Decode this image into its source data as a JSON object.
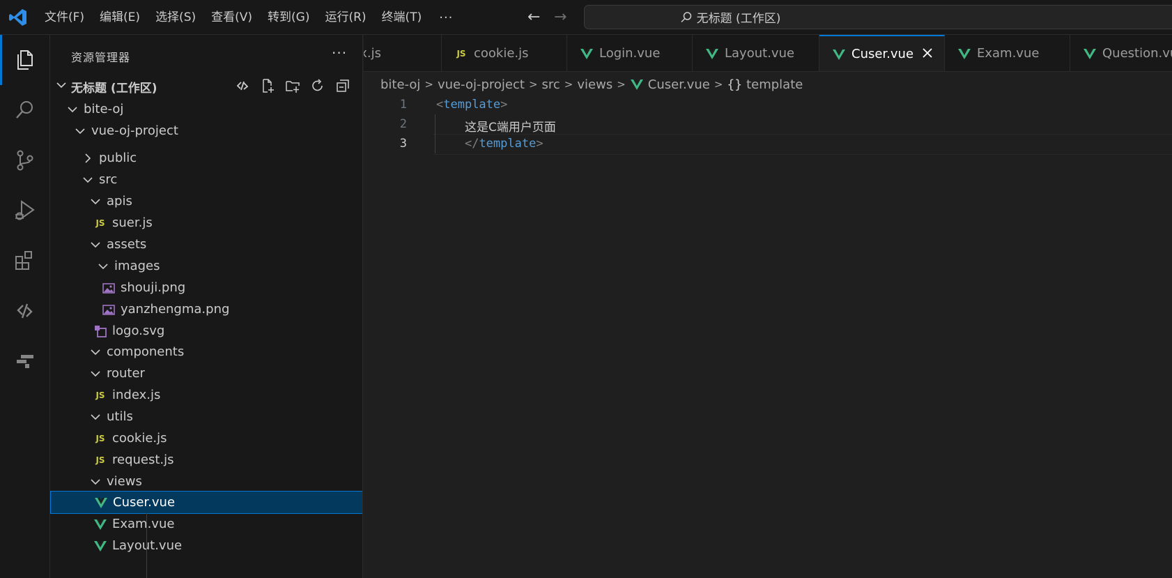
{
  "menu": [
    "文件(F)",
    "编辑(E)",
    "选择(S)",
    "查看(V)",
    "转到(G)",
    "运行(R)",
    "终端(T)"
  ],
  "menu_more": "···",
  "nav": {
    "back": "←",
    "forward": "→"
  },
  "command_center": {
    "text": "无标题 (工作区)"
  },
  "sidebar": {
    "title": "资源管理器",
    "more": "···",
    "workspace": "无标题 (工作区)",
    "tree": [
      {
        "label": "bite-oj",
        "type": "folder-open",
        "depth": 0
      },
      {
        "label": "vue-oj-project",
        "type": "folder-open",
        "depth": 1
      },
      {
        "label": "public",
        "type": "folder-closed",
        "depth": 2
      },
      {
        "label": "src",
        "type": "folder-open",
        "depth": 2
      },
      {
        "label": "apis",
        "type": "folder-open",
        "depth": 3
      },
      {
        "label": "suer.js",
        "type": "js",
        "depth": 4
      },
      {
        "label": "assets",
        "type": "folder-open",
        "depth": 3
      },
      {
        "label": "images",
        "type": "folder-open",
        "depth": 4
      },
      {
        "label": "shouji.png",
        "type": "image",
        "depth": 5
      },
      {
        "label": "yanzhengma.png",
        "type": "image",
        "depth": 5
      },
      {
        "label": "logo.svg",
        "type": "svg",
        "depth": 4
      },
      {
        "label": "components",
        "type": "folder-open",
        "depth": 3
      },
      {
        "label": "router",
        "type": "folder-open",
        "depth": 3
      },
      {
        "label": "index.js",
        "type": "js",
        "depth": 4
      },
      {
        "label": "utils",
        "type": "folder-open",
        "depth": 3
      },
      {
        "label": "cookie.js",
        "type": "js",
        "depth": 4
      },
      {
        "label": "request.js",
        "type": "js",
        "depth": 4
      },
      {
        "label": "views",
        "type": "folder-open",
        "depth": 3
      },
      {
        "label": "Cuser.vue",
        "type": "vue",
        "depth": 4,
        "selected": true
      },
      {
        "label": "Exam.vue",
        "type": "vue",
        "depth": 4
      },
      {
        "label": "Layout.vue",
        "type": "vue",
        "depth": 4
      }
    ]
  },
  "tabs": [
    {
      "label": "x.js",
      "type": "none"
    },
    {
      "label": "cookie.js",
      "type": "js"
    },
    {
      "label": "Login.vue",
      "type": "vue"
    },
    {
      "label": "Layout.vue",
      "type": "vue"
    },
    {
      "label": "Cuser.vue",
      "type": "vue",
      "active": true
    },
    {
      "label": "Exam.vue",
      "type": "vue"
    },
    {
      "label": "Question.vue",
      "type": "vue"
    }
  ],
  "breadcrumb": [
    "bite-oj",
    "vue-oj-project",
    "src",
    "views",
    "Cuser.vue",
    "template"
  ],
  "breadcrumb_sep": ">",
  "editor": {
    "lines": [
      {
        "num": "1",
        "indent": "",
        "parts": [
          [
            "br",
            "<"
          ],
          [
            "tag",
            "template"
          ],
          [
            "br",
            ">"
          ]
        ]
      },
      {
        "num": "2",
        "indent": "    ",
        "parts": [
          [
            "text",
            "这是C端用户页面"
          ]
        ]
      },
      {
        "num": "3",
        "indent": "    ",
        "parts": [
          [
            "br",
            "</"
          ],
          [
            "tag",
            "template"
          ],
          [
            "br",
            ">"
          ]
        ]
      }
    ]
  },
  "colors": {
    "accent": "#0078d4",
    "vue": "#41b883",
    "js": "#cbcb41",
    "image": "#a074c4"
  }
}
